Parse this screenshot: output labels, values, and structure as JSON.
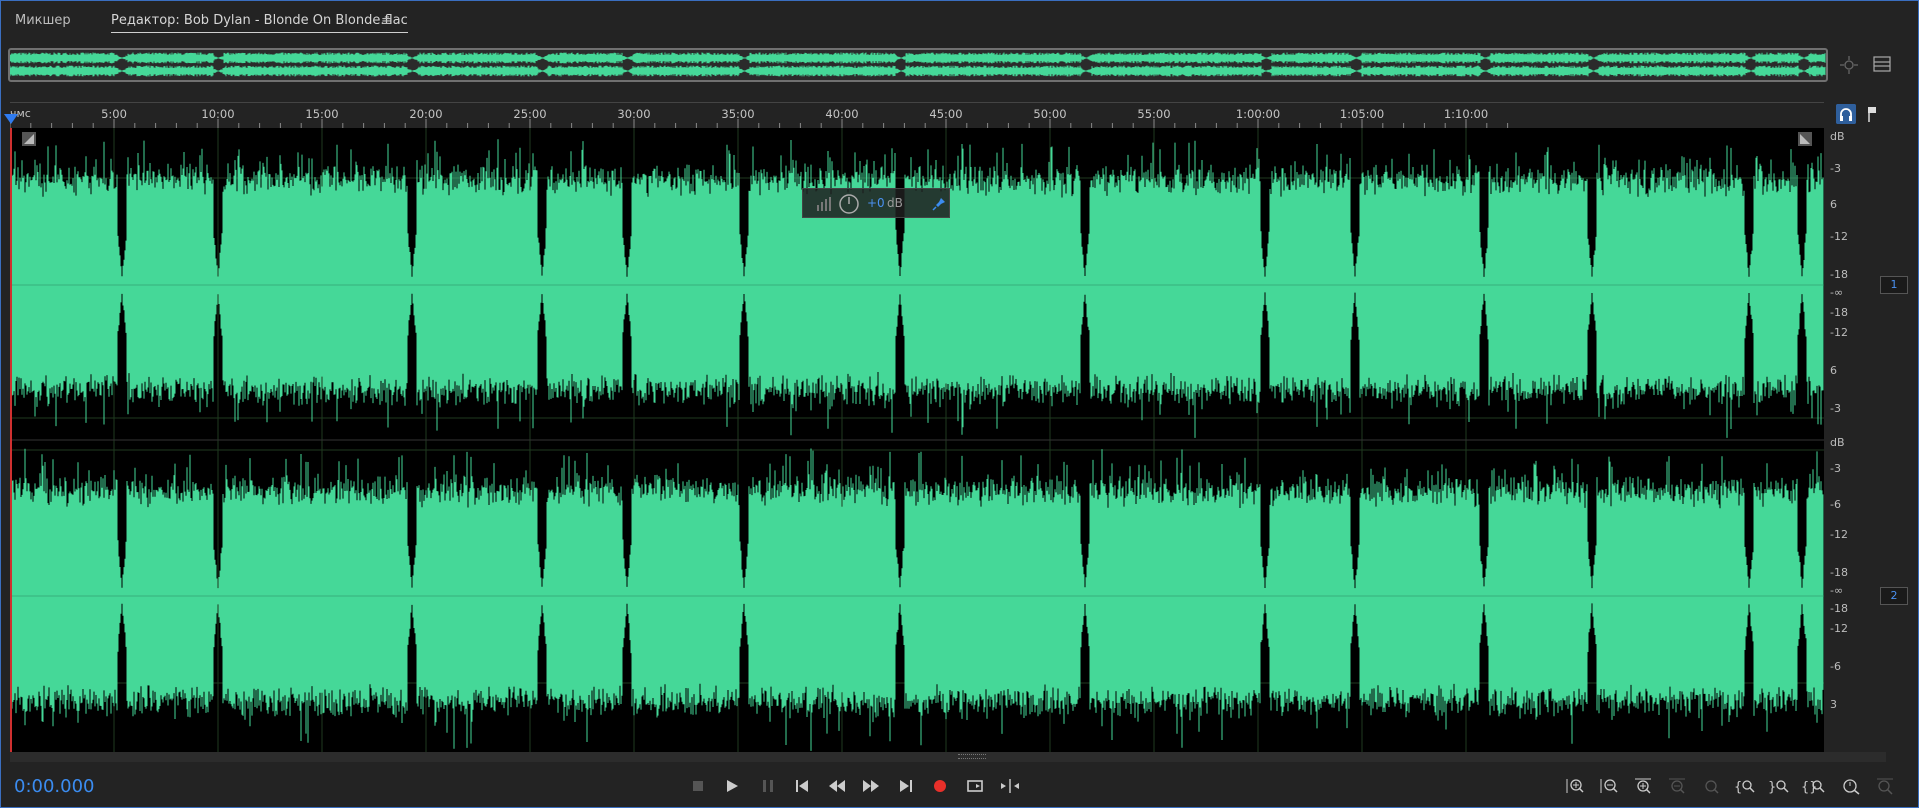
{
  "tabs": {
    "mixer": "Микшер",
    "editor": "Редактор: Bob Dylan - Blonde On Blonde.flac",
    "menu_glyph": "≡"
  },
  "ruler": {
    "unit": "чмс",
    "ticks": [
      "5:00",
      "10:00",
      "15:00",
      "20:00",
      "25:00",
      "30:00",
      "35:00",
      "40:00",
      "45:00",
      "50:00",
      "55:00",
      "1:00:00",
      "1:05:00",
      "1:10:00"
    ]
  },
  "db_scale": {
    "header": "dB",
    "labels": [
      "-3",
      "6",
      "-12",
      "-18",
      "-∞",
      "-18",
      "-12",
      "6",
      "-3"
    ],
    "header2": "dB",
    "labels2": [
      "-3",
      "-6",
      "-12",
      "-18",
      "-∞",
      "-18",
      "-12",
      "-6",
      "3"
    ]
  },
  "channels": [
    "1",
    "2"
  ],
  "hud": {
    "value": "+0",
    "unit": "dB"
  },
  "transport": {
    "timecode": "0:00.000"
  },
  "colors": {
    "waveform": "#45d898",
    "accent": "#3b8cf0",
    "record": "#e8302a"
  },
  "icons": {
    "stop": "stop-icon",
    "play": "play-icon",
    "pause": "pause-icon",
    "to_start": "skip-to-start-icon",
    "rewind": "rewind-icon",
    "forward": "fast-forward-icon",
    "to_end": "skip-to-end-icon",
    "record": "record-icon",
    "loop": "loop-icon",
    "skip": "skip-selection-icon"
  }
}
